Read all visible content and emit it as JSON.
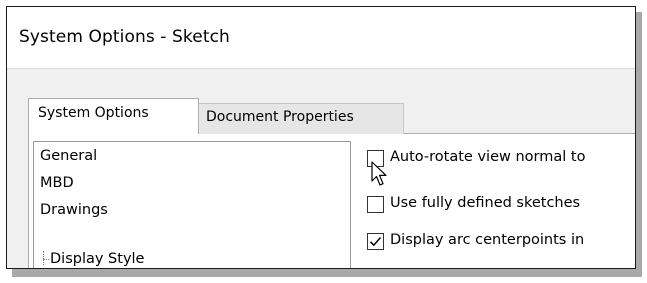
{
  "window": {
    "title": "System Options - Sketch"
  },
  "tabs": [
    {
      "label": "System Options",
      "active": true
    },
    {
      "label": "Document Properties",
      "active": false
    }
  ],
  "tree": {
    "items": [
      "General",
      "MBD",
      "Drawings"
    ],
    "subitems": [
      "Display Style"
    ]
  },
  "options": [
    {
      "label": "Auto-rotate view normal to",
      "checked": false
    },
    {
      "label": "Use fully defined sketches",
      "checked": false
    },
    {
      "label": "Display arc centerpoints in",
      "checked": true
    }
  ],
  "colors": {
    "frame": "#1a1a1a",
    "shadow": "#a9a9a9",
    "dialog_bg": "#f0f0f0"
  },
  "icons": {
    "cursor": "arrow-cursor-icon",
    "check": "checkmark-icon"
  }
}
